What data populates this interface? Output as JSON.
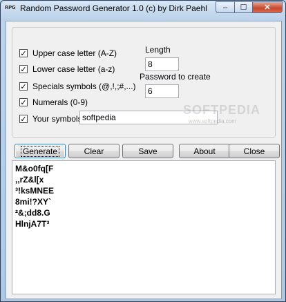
{
  "window": {
    "icon_text": "RPG",
    "title": "Random Password Generator 1.0 (c) by Dirk Paehl",
    "controls": {
      "minimize": "–",
      "maximize": "☐",
      "close": "✕"
    }
  },
  "options": {
    "upper": {
      "label": "Upper case letter (A-Z)",
      "checked": true
    },
    "lower": {
      "label": "Lower case letter (a-z)",
      "checked": true
    },
    "specials": {
      "label": "Specials symbols (@,!,;#,...)",
      "checked": true
    },
    "numerals": {
      "label": "Numerals (0-9)",
      "checked": true
    },
    "your_symbols": {
      "label": "Your symbols",
      "checked": true,
      "value": "softpedia"
    }
  },
  "length": {
    "label": "Length",
    "value": "8"
  },
  "count": {
    "label": "Password to create",
    "value": "6"
  },
  "buttons": {
    "generate": "Generate",
    "clear": "Clear",
    "save": "Save",
    "about": "About",
    "close": "Close"
  },
  "output": {
    "lines": [
      "M&o0fq[F",
      ",,rZ&l[x",
      "³!ksMNEE",
      "8mi!?XY`",
      "²&;dd8.G",
      "HlnjA7T³"
    ]
  },
  "watermark": {
    "text": "SOFTPEDIA",
    "sub": "www.softpedia.com"
  },
  "check_glyph": "✓"
}
